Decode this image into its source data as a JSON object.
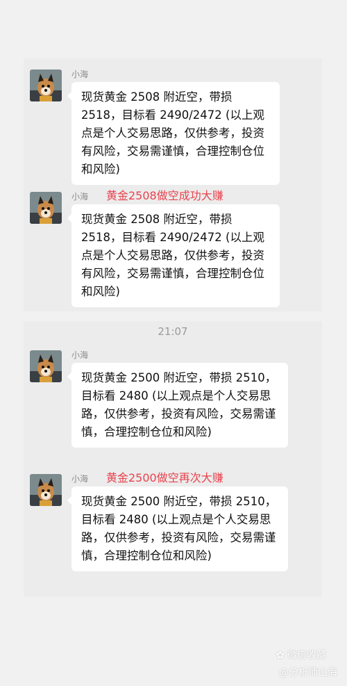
{
  "panel1": {
    "messages": [
      {
        "sender": "小海",
        "tag": "",
        "text": "现货黄金 2508 附近空，带损 2518，目标看 2490/2472 (以上观点是个人交易思路，仅供参考，投资有风险，交易需谨慎，合理控制仓位和风险)"
      },
      {
        "sender": "小海",
        "tag": "黄金2508做空成功大赚",
        "text": "现货黄金 2508 附近空，带损 2518，目标看 2490/2472 (以上观点是个人交易思路，仅供参考，投资有风险，交易需谨慎，合理控制仓位和风险)"
      }
    ]
  },
  "panel2": {
    "timestamp": "21:07",
    "messages": [
      {
        "sender": "小海",
        "tag": "",
        "text": "现货黄金 2500 附近空，带损 2510，目标看 2480 (以上观点是个人交易思路，仅供参考，投资有风险，交易需谨慎，合理控制仓位和风险)"
      },
      {
        "sender": "小海",
        "tag": "黄金2500做空再次大赚",
        "text": "现货黄金 2500 附近空，带损 2510，目标看 2480 (以上观点是个人交易思路，仅供参考，投资有风险，交易需谨慎，合理控制仓位和风险)"
      }
    ]
  },
  "watermark": {
    "line1": "微信收藏",
    "line2": "@分析师山海"
  },
  "colors": {
    "background": "#f1f1f1",
    "panel": "#ececec",
    "bubble": "#ffffff",
    "tag_red": "#e8434e"
  }
}
